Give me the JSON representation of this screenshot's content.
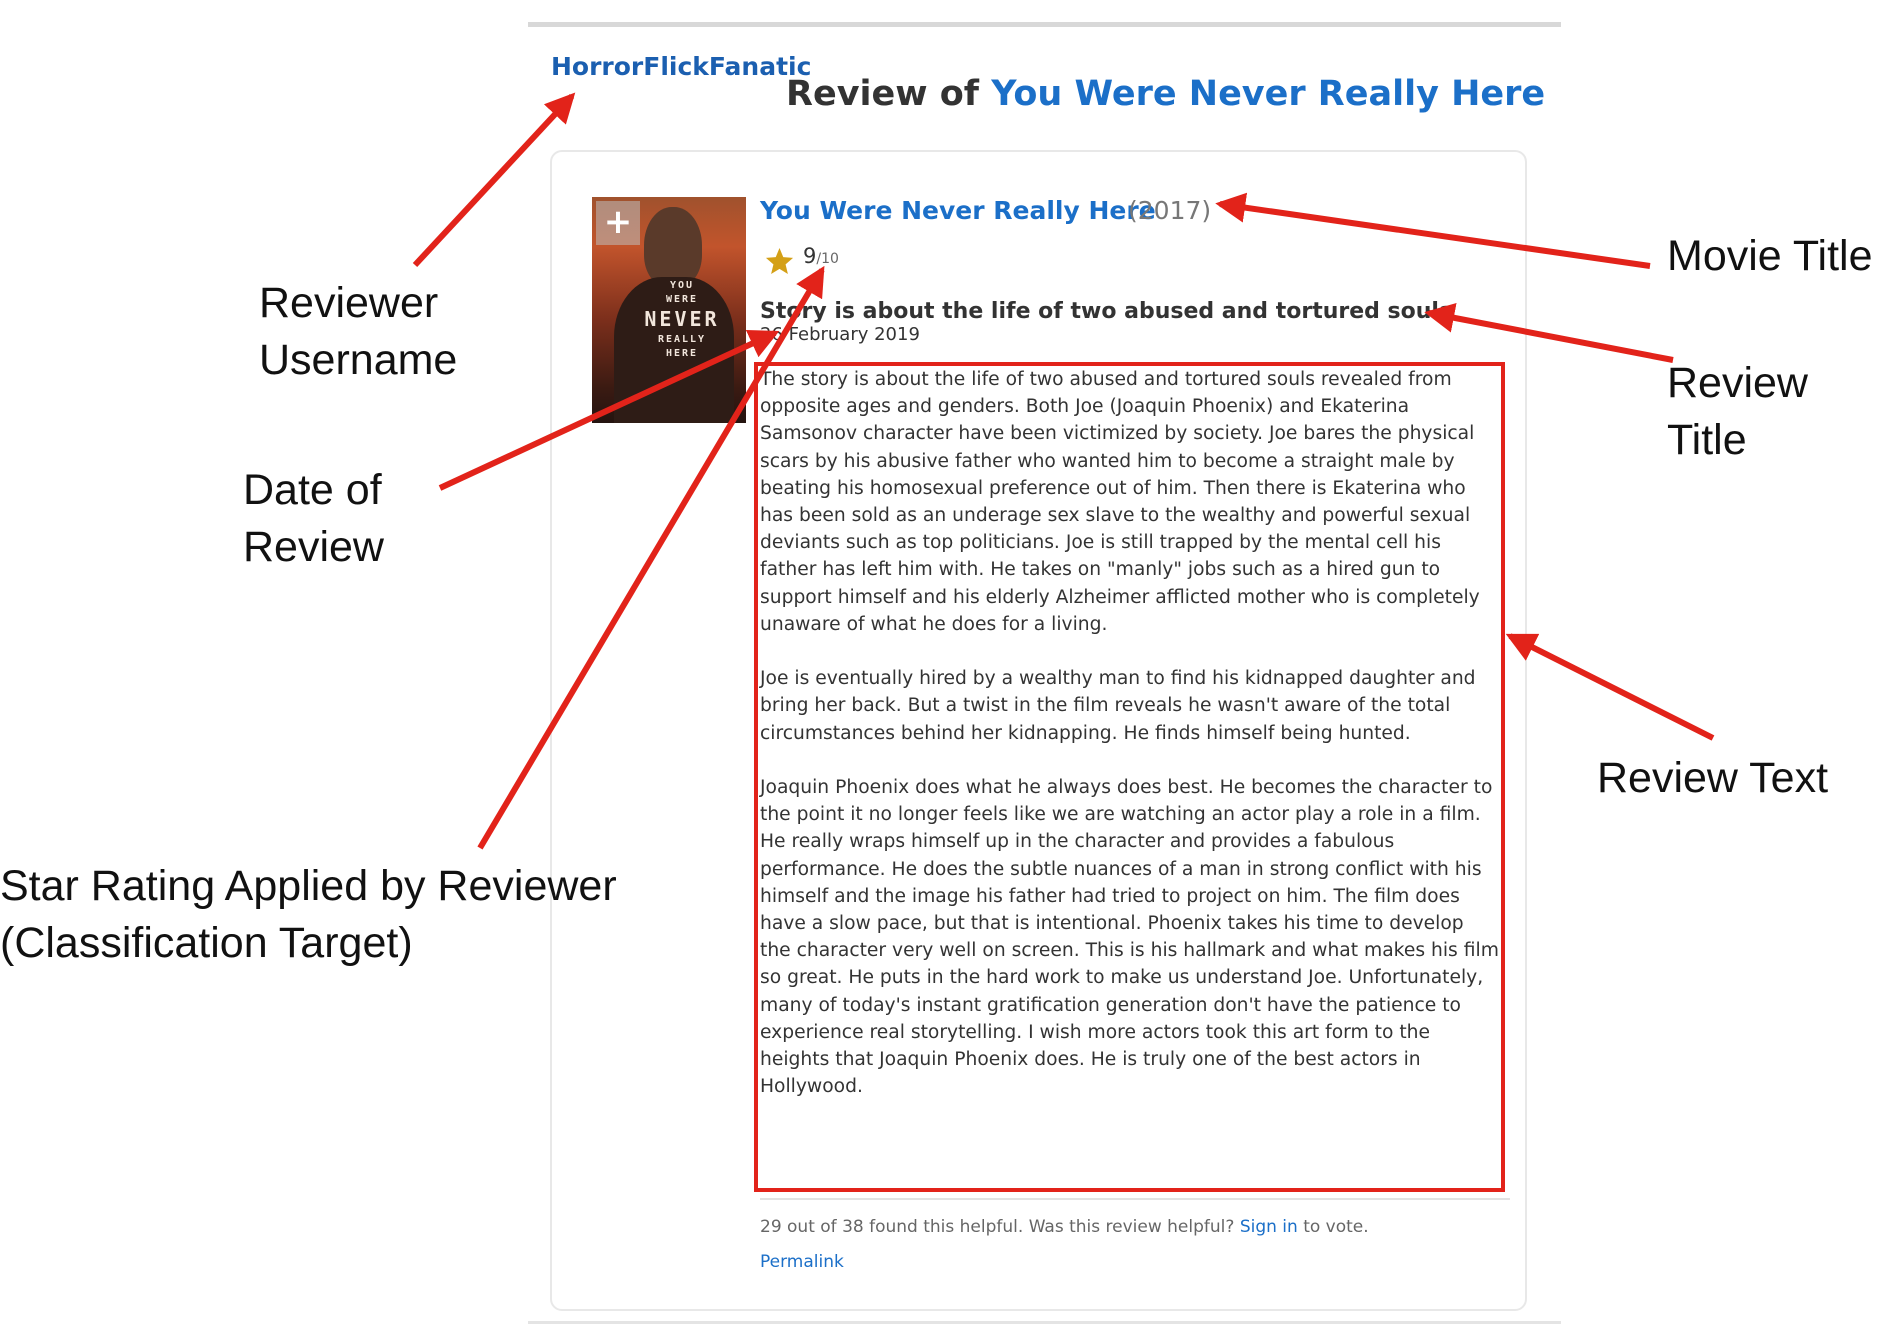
{
  "review_page": {
    "username": "HorrorFlickFanatic",
    "page_title_prefix": "Review of",
    "page_title_movie": "You Were Never Really Here",
    "movie_title": "You Were Never Really Here",
    "movie_year": "(2017)",
    "rating_value": "9",
    "rating_max": "/10",
    "review_title": "Story is about the life of two abused and tortured souls",
    "review_date": "26 February 2019",
    "review_paragraphs": [
      "The story is about the life of two abused and tortured souls revealed from opposite ages and genders. Both Joe (Joaquin Phoenix) and Ekaterina Samsonov character have been victimized by society. Joe bares the physical scars by his abusive father who wanted him to become a straight male by beating his homosexual preference out of him. Then there is Ekaterina who has been sold as an underage sex slave to the wealthy and powerful sexual deviants such as top politicians. Joe is still trapped by the mental cell his father has left him with. He takes on \"manly\" jobs such as a hired gun to support himself and his elderly Alzheimer afflicted mother who is completely unaware of what he does for a living.",
      "Joe is eventually hired by a wealthy man to find his kidnapped daughter and bring her back. But a twist in the film reveals he wasn't aware of the total circumstances behind her kidnapping. He finds himself being hunted.",
      "Joaquin Phoenix does what he always does best. He becomes the character to the point it no longer feels like we are watching an actor play a role in a film. He really wraps himself up in the character and provides a fabulous performance. He does the subtle nuances of a man in strong conflict with his himself and the image his father had tried to project on him. The film does have a slow pace, but that is intentional. Phoenix takes his time to develop the character very well on screen. This is his hallmark and what makes his film so great. He puts in the hard work to make us understand Joe. Unfortunately, many of today's instant gratification generation don't have the patience to experience real storytelling. I wish more actors took this art form to the heights that Joaquin Phoenix does. He is truly one of the best actors in Hollywood."
    ],
    "helpful_prefix": "29 out of 38 found this helpful. Was this review helpful?",
    "sign_in": "Sign in",
    "helpful_suffix": "to vote.",
    "permalink": "Permalink",
    "poster": {
      "line1": "YOU",
      "line2": "WERE",
      "line3": "NEVER",
      "line4": "REALLY",
      "line5": "HERE"
    }
  },
  "annotations": {
    "reviewer_username": [
      "Reviewer",
      "Username"
    ],
    "date_of_review": [
      "Date of",
      "Review"
    ],
    "star_rating": [
      "Star Rating Applied by Reviewer",
      "(Classification Target)"
    ],
    "movie_title": [
      "Movie Title"
    ],
    "review_title": [
      "Review",
      "Title"
    ],
    "review_text": [
      "Review Text"
    ]
  },
  "colors": {
    "arrow": "#e2231a",
    "link": "#1b6fc8",
    "star": "#d4a017"
  }
}
